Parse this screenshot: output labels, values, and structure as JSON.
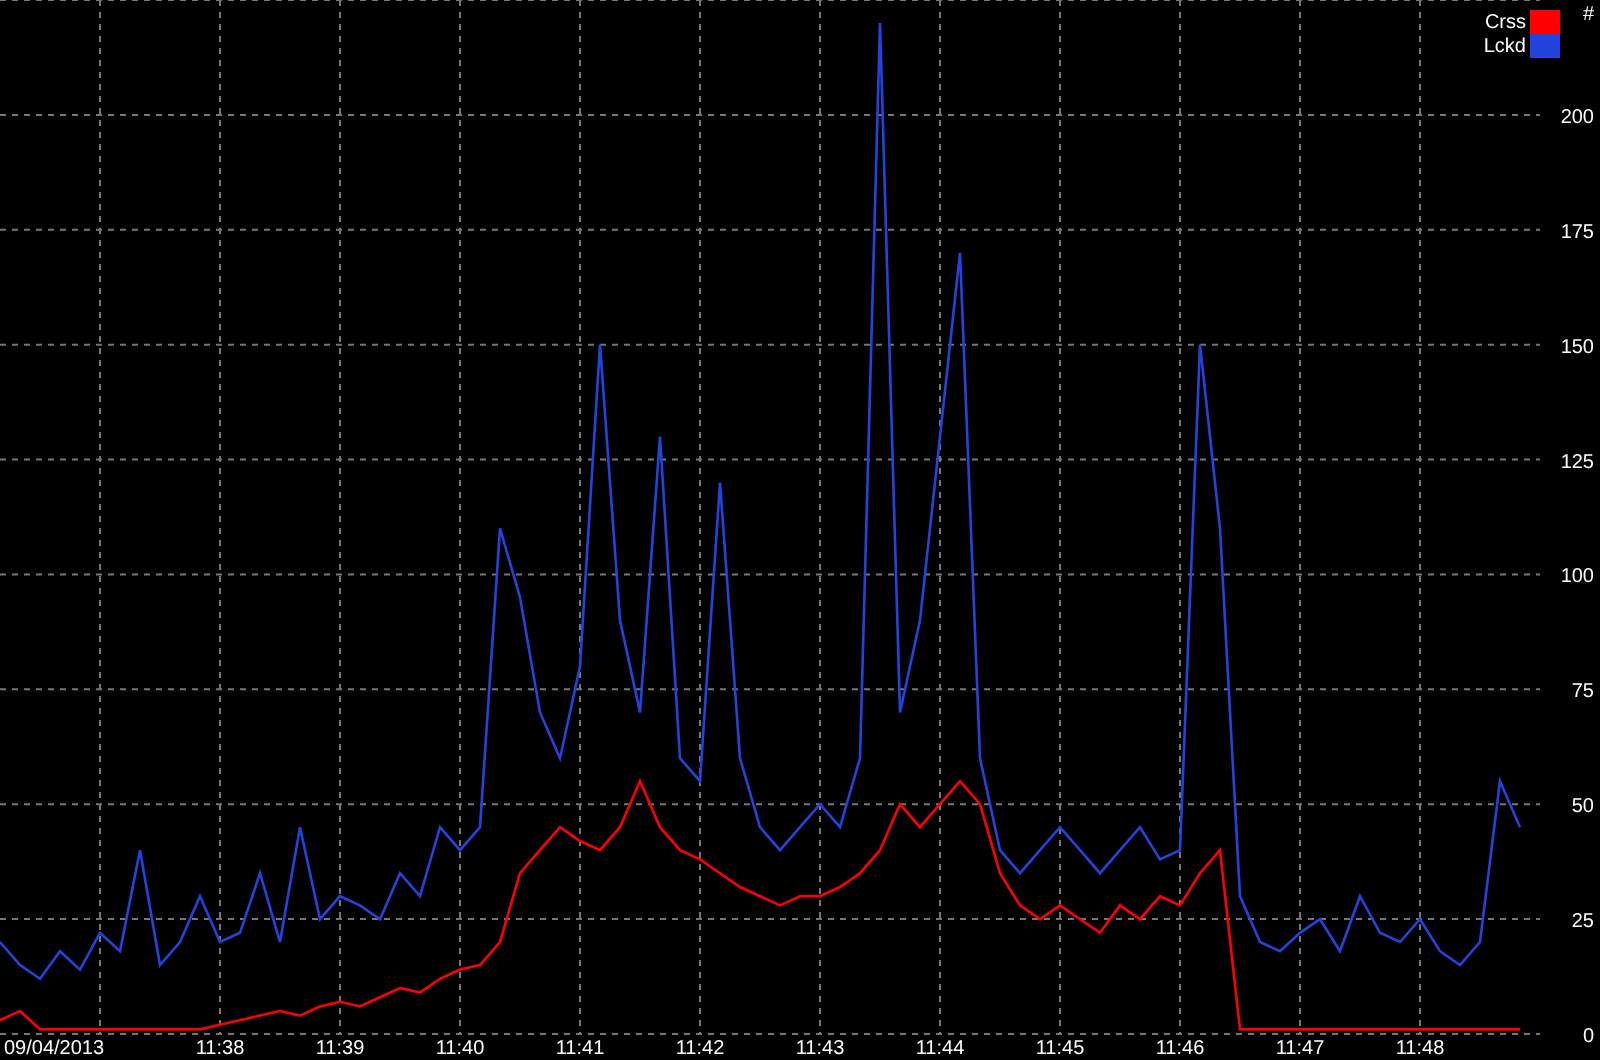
{
  "chart": {
    "date_label": "09/04/2013",
    "unit_label": "#",
    "chart_data": {
      "type": "line",
      "categories": [
        null,
        null,
        null,
        null,
        null,
        null,
        null,
        null,
        null,
        null,
        null,
        "11:38",
        null,
        null,
        null,
        null,
        null,
        "11:39",
        null,
        null,
        null,
        null,
        null,
        "11:40",
        null,
        null,
        null,
        null,
        null,
        "11:41",
        null,
        null,
        null,
        null,
        null,
        "11:42",
        null,
        null,
        null,
        null,
        null,
        "11:43",
        null,
        null,
        null,
        null,
        null,
        "11:44",
        null,
        null,
        null,
        null,
        null,
        "11:45",
        null,
        null,
        null,
        null,
        null,
        "11:46",
        null,
        null,
        null,
        null,
        null,
        "11:47",
        null,
        null,
        null,
        null,
        null,
        "11:48",
        null,
        null,
        null,
        null,
        null
      ],
      "ylim": [
        0,
        225
      ],
      "grid": true,
      "legend": true,
      "yticks": [
        0,
        25,
        50,
        75,
        100,
        125,
        150,
        175,
        200
      ],
      "series": [
        {
          "name": "Crss",
          "color": "#ff0000",
          "values": [
            3,
            5,
            1,
            1,
            1,
            1,
            1,
            1,
            1,
            1,
            1,
            2,
            3,
            4,
            5,
            4,
            6,
            7,
            6,
            8,
            10,
            9,
            12,
            14,
            15,
            20,
            35,
            40,
            45,
            42,
            40,
            45,
            55,
            45,
            40,
            38,
            35,
            32,
            30,
            28,
            30,
            30,
            32,
            35,
            40,
            50,
            45,
            50,
            55,
            50,
            35,
            28,
            25,
            28,
            25,
            22,
            28,
            25,
            30,
            28,
            35,
            40,
            1,
            1,
            1,
            1,
            1,
            1,
            1,
            1,
            1,
            1,
            1,
            1,
            1,
            1,
            1
          ]
        },
        {
          "name": "Lckd",
          "color": "#2244dd",
          "values": [
            20,
            15,
            12,
            18,
            14,
            22,
            18,
            40,
            15,
            20,
            30,
            20,
            22,
            35,
            20,
            45,
            25,
            30,
            28,
            25,
            35,
            30,
            45,
            40,
            45,
            110,
            95,
            70,
            60,
            80,
            150,
            90,
            70,
            130,
            60,
            55,
            120,
            60,
            45,
            40,
            45,
            50,
            45,
            60,
            220,
            70,
            90,
            130,
            170,
            60,
            40,
            35,
            40,
            45,
            40,
            35,
            40,
            45,
            38,
            40,
            150,
            110,
            30,
            20,
            18,
            22,
            25,
            18,
            30,
            22,
            20,
            25,
            18,
            15,
            20,
            55,
            45
          ]
        }
      ]
    }
  }
}
